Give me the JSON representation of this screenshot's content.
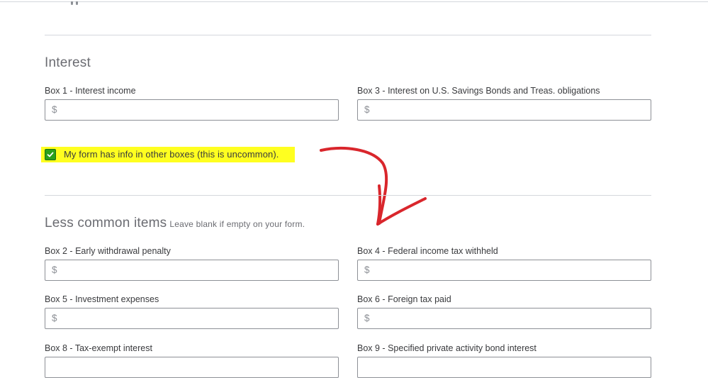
{
  "interest_section": {
    "title": "Interest",
    "box1": {
      "label": "Box 1 - Interest income",
      "prefix": "$",
      "value": ""
    },
    "box3": {
      "label": "Box 3 - Interest on U.S. Savings Bonds and Treas. obligations",
      "prefix": "$",
      "value": ""
    }
  },
  "other_boxes_toggle": {
    "label": "My form has info in other boxes (this is uncommon).",
    "checked": true
  },
  "less_common_section": {
    "title": "Less common items",
    "subtitle": "Leave blank if empty on your form.",
    "box2": {
      "label": "Box 2 - Early withdrawal penalty",
      "prefix": "$",
      "value": ""
    },
    "box4": {
      "label": "Box 4 - Federal income tax withheld",
      "prefix": "$",
      "value": ""
    },
    "box5": {
      "label": "Box 5 - Investment expenses",
      "prefix": "$",
      "value": ""
    },
    "box6": {
      "label": "Box 6 - Foreign tax paid",
      "prefix": "$",
      "value": ""
    },
    "box8": {
      "label": "Box 8 - Tax-exempt interest"
    },
    "box9": {
      "label": "Box 9 - Specified private activity bond interest"
    }
  },
  "colors": {
    "checkbox_green": "#2ca01c",
    "highlight_yellow": "#ffff20",
    "annotation_arrow_red": "#d9262c"
  },
  "icons": [
    "checkmark-icon",
    "annotation-arrow"
  ]
}
